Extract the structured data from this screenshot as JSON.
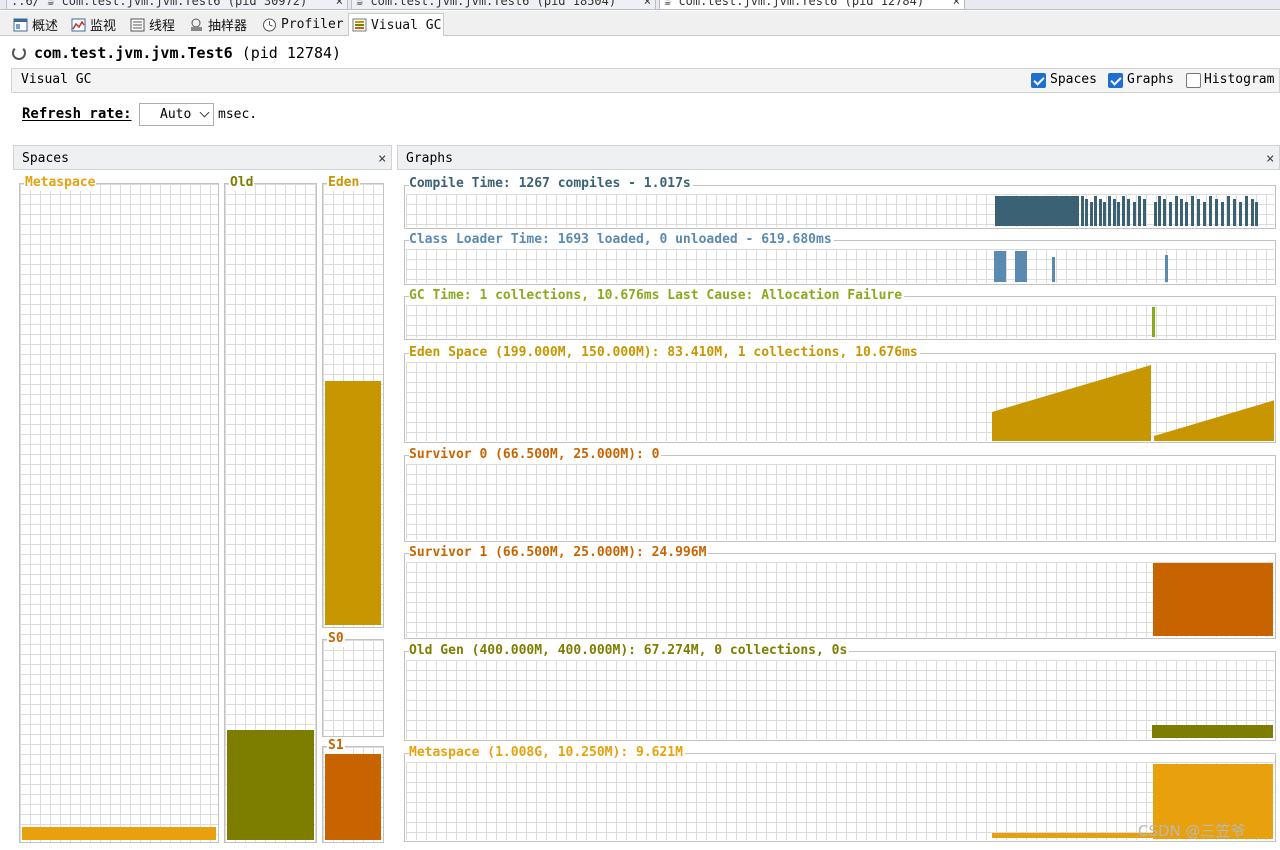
{
  "doc_tabs": [
    {
      "label": "..6/ ☕ com.test.jvm.jvm.Test6 (pid 30972)",
      "active": false
    },
    {
      "label": "☕ com.test.jvm.jvm.Test6 (pid 18504)",
      "active": false
    },
    {
      "label": "☕ com.test.jvm.jvm.Test6 (pid 12784)",
      "active": true
    }
  ],
  "sub_tabs": [
    {
      "label": "概述",
      "icon": "overview-icon"
    },
    {
      "label": "监视",
      "icon": "monitor-icon"
    },
    {
      "label": "线程",
      "icon": "threads-icon"
    },
    {
      "label": "抽样器",
      "icon": "sampler-icon"
    },
    {
      "label": "Profiler",
      "icon": "profiler-icon"
    },
    {
      "label": "Visual GC",
      "icon": "visual-gc-icon"
    }
  ],
  "header": {
    "app_name": "com.test.jvm.jvm.Test6",
    "pid": "(pid 12784)"
  },
  "visual_gc": {
    "title": "Visual GC",
    "options": [
      {
        "label": "Spaces",
        "checked": true
      },
      {
        "label": "Graphs",
        "checked": true
      },
      {
        "label": "Histogram",
        "checked": false
      }
    ],
    "refresh_label": "Refresh rate:",
    "refresh_value": "Auto",
    "refresh_unit": "msec."
  },
  "spaces_panel": {
    "title": "Spaces",
    "spaces": [
      {
        "name": "Metaspace",
        "fill": 0.02,
        "color": "#e8a10c",
        "label_color": "#e8a10c"
      },
      {
        "name": "Old",
        "fill": 0.168,
        "color": "#7d7d00",
        "label_color": "#7d7d00"
      },
      {
        "name": "Eden",
        "fill": 0.556,
        "color": "#c89600",
        "label_color": "#c89600"
      },
      {
        "name": "S0",
        "fill": 0.0,
        "color": "#c86400",
        "label_color": "#c86400"
      },
      {
        "name": "S1",
        "fill": 0.94,
        "color": "#c86400",
        "label_color": "#c86400"
      }
    ]
  },
  "graphs_panel": {
    "title": "Graphs",
    "graphs": [
      {
        "title": "Compile Time: 1267 compiles - 1.017s",
        "color": "#3a6274",
        "title_color": "#3a6274"
      },
      {
        "title": "Class Loader Time: 1693 loaded, 0 unloaded - 619.680ms",
        "color": "#5a8ab0",
        "title_color": "#5a8ab0"
      },
      {
        "title": "GC Time: 1 collections, 10.676ms Last Cause: Allocation Failure",
        "color": "#8aaa1e",
        "title_color": "#8aaa1e"
      },
      {
        "title": "Eden Space (199.000M, 150.000M): 83.410M, 1 collections, 10.676ms",
        "color": "#c89600",
        "title_color": "#c89600"
      },
      {
        "title": "Survivor 0 (66.500M, 25.000M): 0",
        "color": "#c86400",
        "title_color": "#c86400"
      },
      {
        "title": "Survivor 1 (66.500M, 25.000M): 24.996M",
        "color": "#c86400",
        "title_color": "#c86400"
      },
      {
        "title": "Old Gen (400.000M, 400.000M): 67.274M, 0 collections, 0s",
        "color": "#7d7d00",
        "title_color": "#7d7d00"
      },
      {
        "title": "Metaspace (1.008G, 10.250M): 9.621M",
        "color": "#e8a10c",
        "title_color": "#e8a10c"
      }
    ]
  },
  "watermark": "CSDN @三笠爷"
}
